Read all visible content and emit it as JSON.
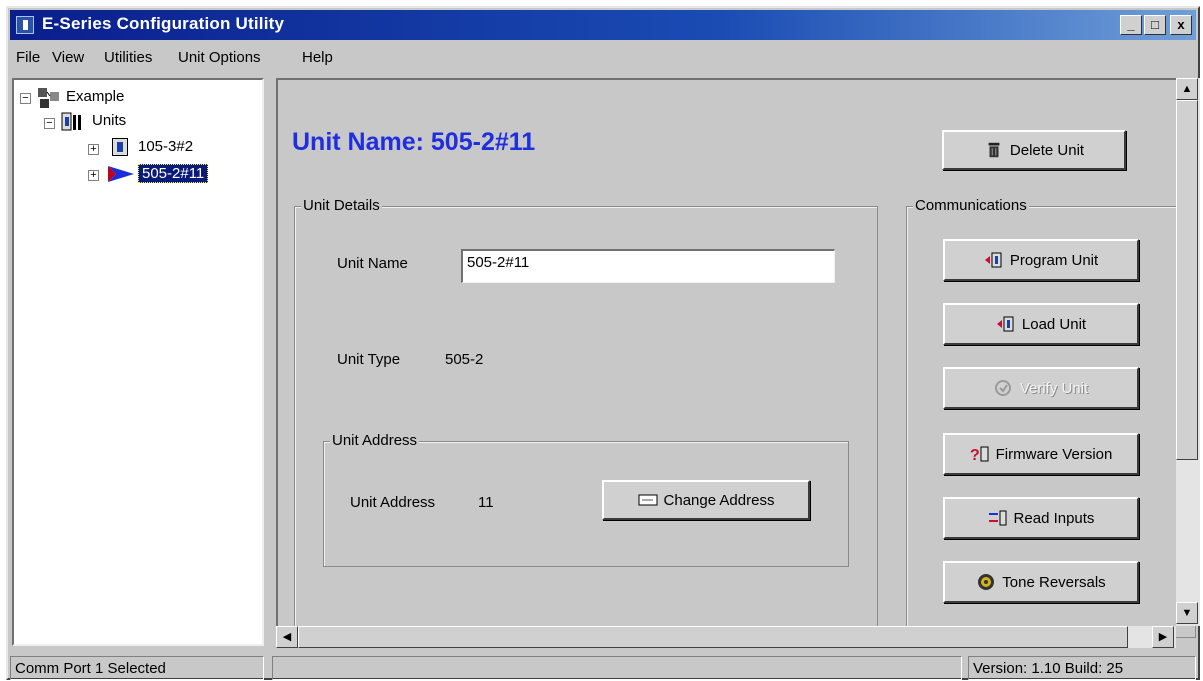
{
  "window": {
    "title": "E-Series Configuration Utility"
  },
  "titlebar_buttons": {
    "minimize": "_",
    "maximize": "□",
    "close": "x"
  },
  "menu": {
    "items": [
      "File",
      "View",
      "Utilities",
      "Unit Options",
      "Help"
    ]
  },
  "tree": {
    "root": "Example",
    "units_folder": "Units",
    "units": [
      {
        "label": "105-3#2",
        "selected": false
      },
      {
        "label": "505-2#11",
        "selected": true
      }
    ]
  },
  "main": {
    "title": "Unit Name: 505-2#11",
    "delete_button": "Delete Unit",
    "unit_details": {
      "group_label": "Unit Details",
      "unit_name_label": "Unit Name",
      "unit_name_value": "505-2#11",
      "unit_type_label": "Unit Type",
      "unit_type_value": "505-2",
      "unit_address": {
        "group_label": "Unit Address",
        "label": "Unit Address",
        "value": "11",
        "change_button": "Change Address"
      }
    },
    "communications": {
      "group_label": "Communications",
      "buttons": [
        {
          "label": "Program Unit",
          "enabled": true
        },
        {
          "label": "Load Unit",
          "enabled": true
        },
        {
          "label": "Verify Unit",
          "enabled": false
        },
        {
          "label": "Firmware Version",
          "enabled": true
        },
        {
          "label": "Read Inputs",
          "enabled": true
        },
        {
          "label": "Tone Reversals",
          "enabled": true
        }
      ]
    }
  },
  "status": {
    "left": "Comm Port 1 Selected",
    "middle": "",
    "right": "Version: 1.10 Build: 25"
  },
  "colors": {
    "title_blue": "#1f2fe0",
    "titlebar_start": "#0a1e8c",
    "titlebar_end": "#6f9fd8",
    "face": "#c8c8c8",
    "selection": "#0a1a7a"
  }
}
